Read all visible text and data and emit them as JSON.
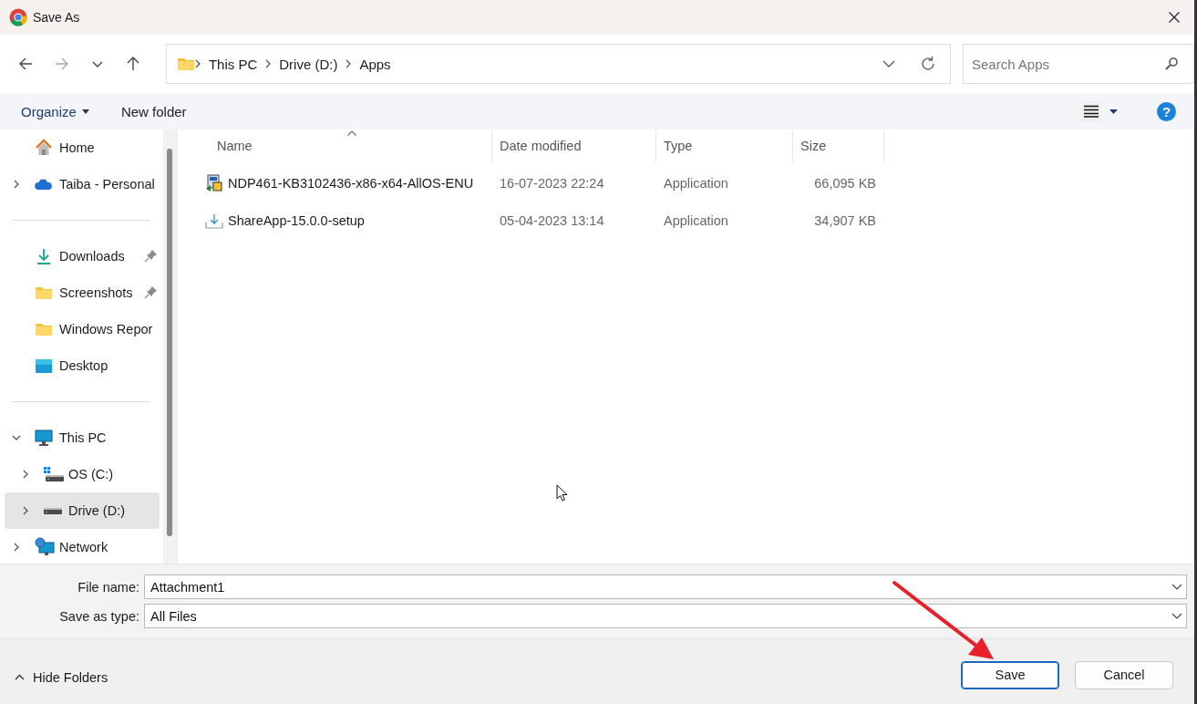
{
  "window": {
    "title": "Save As"
  },
  "navigation": [
    {
      "kind": "back",
      "disabled": false
    },
    {
      "kind": "forward",
      "disabled": true
    },
    {
      "kind": "recent",
      "disabled": false
    },
    {
      "kind": "up",
      "disabled": false
    }
  ],
  "address_bar": {
    "path": [
      "This PC",
      "Drive (D:)",
      "Apps"
    ]
  },
  "search": {
    "placeholder": "Search Apps"
  },
  "toolbar": {
    "organize": "Organize",
    "new_folder": "New folder",
    "help": "?"
  },
  "sidebar": {
    "groups": [
      [
        {
          "label": "Home",
          "kind": "home",
          "expandable": false,
          "expanded": false,
          "pinned": false,
          "selected": false
        },
        {
          "label": "Taiba - Personal",
          "kind": "cloud",
          "expandable": true,
          "expanded": false,
          "pinned": false,
          "selected": false
        }
      ],
      [
        {
          "label": "Downloads",
          "kind": "download",
          "expandable": false,
          "expanded": false,
          "pinned": true,
          "selected": false
        },
        {
          "label": "Screenshots",
          "kind": "folder",
          "expandable": false,
          "expanded": false,
          "pinned": true,
          "selected": false
        },
        {
          "label": "Windows Repor",
          "kind": "folder",
          "expandable": false,
          "expanded": false,
          "pinned": false,
          "selected": false
        },
        {
          "label": "Desktop",
          "kind": "desktop",
          "expandable": false,
          "expanded": false,
          "pinned": false,
          "selected": false
        }
      ],
      [
        {
          "label": "This PC",
          "kind": "pc",
          "expandable": true,
          "expanded": true,
          "pinned": false,
          "selected": false,
          "children": [
            {
              "label": "OS (C:)",
              "kind": "system-drive",
              "expandable": true,
              "expanded": false,
              "pinned": false,
              "selected": false
            },
            {
              "label": "Drive (D:)",
              "kind": "drive",
              "expandable": true,
              "expanded": false,
              "pinned": false,
              "selected": true
            }
          ]
        },
        {
          "label": "Network",
          "kind": "network",
          "expandable": true,
          "expanded": false,
          "pinned": false,
          "selected": false
        }
      ]
    ]
  },
  "table": {
    "columns": [
      {
        "label": "Name",
        "sorted": true
      },
      {
        "label": "Date modified",
        "sorted": false
      },
      {
        "label": "Type",
        "sorted": false
      },
      {
        "label": "Size",
        "sorted": false
      }
    ],
    "rows": [
      {
        "kind": "installer",
        "name": "NDP461-KB3102436-x86-x64-AllOS-ENU",
        "date": "16-07-2023 22:24",
        "type": "Application",
        "size": "66,095 KB",
        "selected": false
      },
      {
        "kind": "setup",
        "name": "ShareApp-15.0.0-setup",
        "date": "05-04-2023 13:14",
        "type": "Application",
        "size": "34,907 KB",
        "selected": false
      }
    ]
  },
  "footer": {
    "file_name": {
      "label": "File name:",
      "value": "Attachment1"
    },
    "save_as_type": {
      "label": "Save as type:",
      "value": "All Files"
    },
    "hide_folders": "Hide Folders",
    "buttons": [
      {
        "label": "Save",
        "default": true
      },
      {
        "label": "Cancel",
        "default": false
      }
    ]
  }
}
